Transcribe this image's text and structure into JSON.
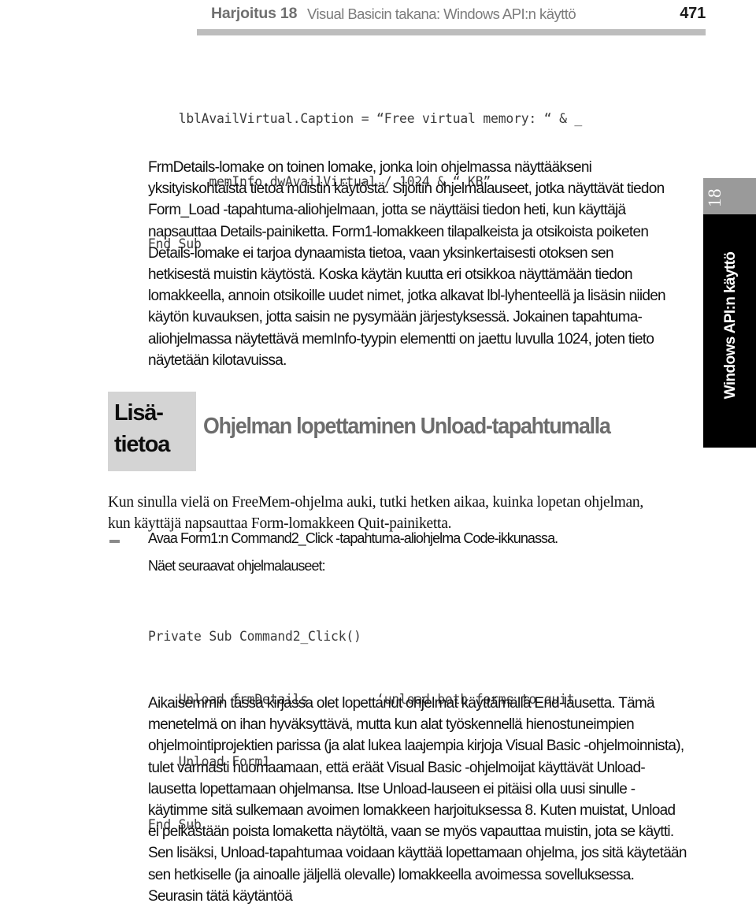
{
  "header": {
    "chapter_label": "Harjoitus 18",
    "title": "Visual Basicin takana: Windows API:n käyttö",
    "page_number": "471"
  },
  "code_block_1": {
    "lines": [
      "    lblAvailVirtual.Caption = “Free virtual memory: “ & _",
      "        memInfo.dwAvailVirtual / 1024 & “ KB”",
      "End Sub"
    ]
  },
  "paragraph_frmdetails": "FrmDetails-lomake on toinen lomake, jonka loin ohjelmassa näyttääkseni yksityiskohtaista tietoa muistin käytöstä. Sijoitin ohjelmalauseet, jotka näyttävät tiedon Form_Load -tapahtuma-aliohjelmaan, jotta se näyttäisi tiedon heti, kun käyttäjä napsauttaa Details-painiketta. Form1-lomakkeen tilapalkeista ja otsikoista poiketen Details-lomake ei tarjoa dynaamista tietoa, vaan yksinkertaisesti otoksen sen hetkisestä muistin käytöstä. Koska käytän kuutta eri otsikkoa näyttämään tiedon lomakkeella, annoin otsikoille uudet nimet, jotka alkavat lbl-lyhenteellä ja lisäsin niiden käytön kuvauksen, jotta saisin ne pysymään järjestyksessä. Jokainen tapahtuma-aliohjelmassa näytettävä memInfo-tyypin elementti on jaettu luvulla 1024, joten tieto näytetään kilotavuissa.",
  "note_box": {
    "label": "Lisä-\ntietoa",
    "heading": "Ohjelman lopettaminen Unload-tapahtumalla",
    "paragraph": "Kun sinulla vielä on FreeMem-ohjelma auki, tutki hetken aikaa, kuinka lopetan ohjelman, kun käyttäjä napsauttaa Form-lomakkeen Quit-painiketta."
  },
  "step": {
    "marker": "–",
    "line_1": "Avaa Form1:n Command2_Click -tapahtuma-aliohjelma Code-ikkunassa.",
    "line_2": "Näet seuraavat ohjelmalauseet:"
  },
  "code_block_2": {
    "lines": [
      "Private Sub Command2_Click()",
      "    Unload frmDetails         ‘unload both forms to quit",
      "    Unload Form1",
      "End Sub"
    ]
  },
  "paragraph_final": "Aikaisemmin tässä kirjassa olet lopettanut ohjelmat käyttämällä End-lausetta. Tämä menetelmä on ihan hyväksyttävä, mutta kun alat työskennellä hienostuneimpien ohjelmointiprojektien parissa (ja alat lukea laajempia kirjoja Visual Basic -ohjelmoinnista), tulet varmasti huomaamaan, että eräät Visual Basic -ohjelmoijat käyttävät Unload-lausetta lopettamaan ohjelmansa. Itse Unload-lauseen ei pitäisi olla uusi sinulle - käytimme sitä sulkemaan avoimen lomakkeen harjoituksessa 8. Kuten muistat, Unload ei pelkästään poista lomaketta näytöltä, vaan se myös vapauttaa muistin, jota se käytti. Sen lisäksi, Unload-tapahtumaa voidaan käyttää lopettamaan ohjelma, jos sitä käytetään sen hetkiselle (ja ainoalle jäljellä olevalle) lomakkeella avoimessa sovelluksessa. Seurasin tätä käytäntöä",
  "margin_tab": {
    "chapter_number": "18",
    "chapter_title": "Windows API:n käyttö"
  },
  "colors": {
    "header_rule": "#bdbdbd",
    "header_text": "#7c7c7c",
    "note_box_bg": "#d4d4d4",
    "note_heading": "#6d6d6d",
    "margin_tab_number_bg": "#9a9a9a",
    "margin_tab_bg": "#000000",
    "body_text": "#101010"
  }
}
